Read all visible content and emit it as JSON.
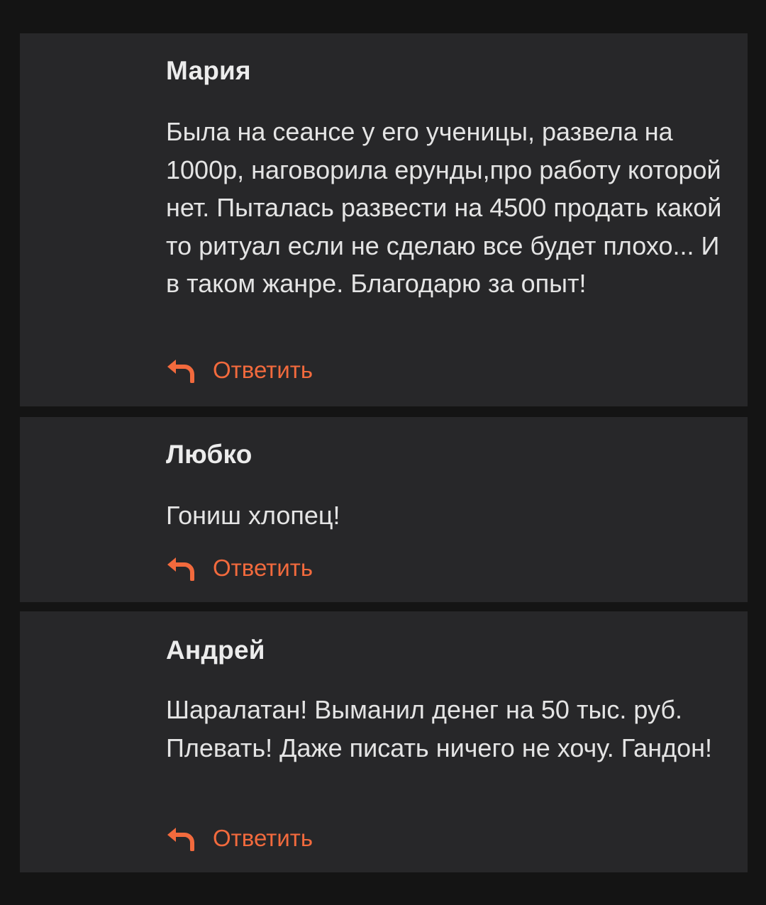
{
  "accent_color": "#f26a3d",
  "comments": [
    {
      "author": "Мария",
      "text": "Была на сеансе у его ученицы, развела на 1000р, наговорила ерунды,про работу которой нет. Пыталась развести на 4500 продать какой то ритуал если не сделаю все будет плохо... И в таком жанре. Благодарю за опыт!",
      "reply_label": "Ответить",
      "reply_icon": "reply-arrow-icon"
    },
    {
      "author": "Любко",
      "text": "Гониш хлопец!",
      "reply_label": "Ответить",
      "reply_icon": "reply-arrow-icon"
    },
    {
      "author": "Андрей",
      "text": "Шаралатан! Выманил денег на 50 тыс. руб. Плевать! Даже писать ничего не хочу. Гандон!",
      "reply_label": "Ответить",
      "reply_icon": "reply-arrow-icon"
    }
  ]
}
